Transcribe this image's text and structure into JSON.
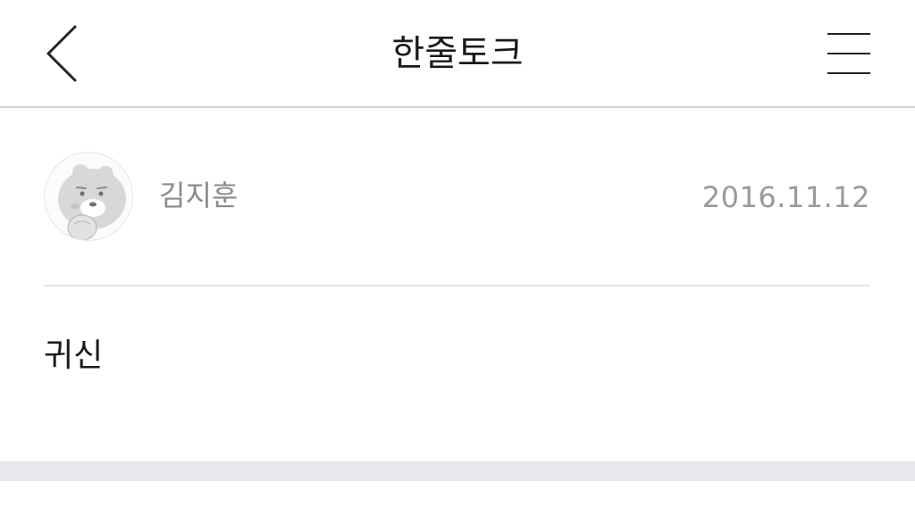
{
  "header": {
    "title": "한줄토크",
    "back_icon": "chevron-left-icon",
    "menu_icon": "hamburger-menu-icon"
  },
  "post": {
    "author": "김지훈",
    "date": "2016.11.12",
    "avatar_icon": "bear-character-avatar",
    "body": "귀신"
  },
  "colors": {
    "header_divider": "#d4d4d4",
    "section_divider": "#e4e4e4",
    "author_text": "#8a8a8a",
    "date_text": "#9a9a9a",
    "body_text": "#1a1a1a",
    "band": "#e8e8ec"
  }
}
